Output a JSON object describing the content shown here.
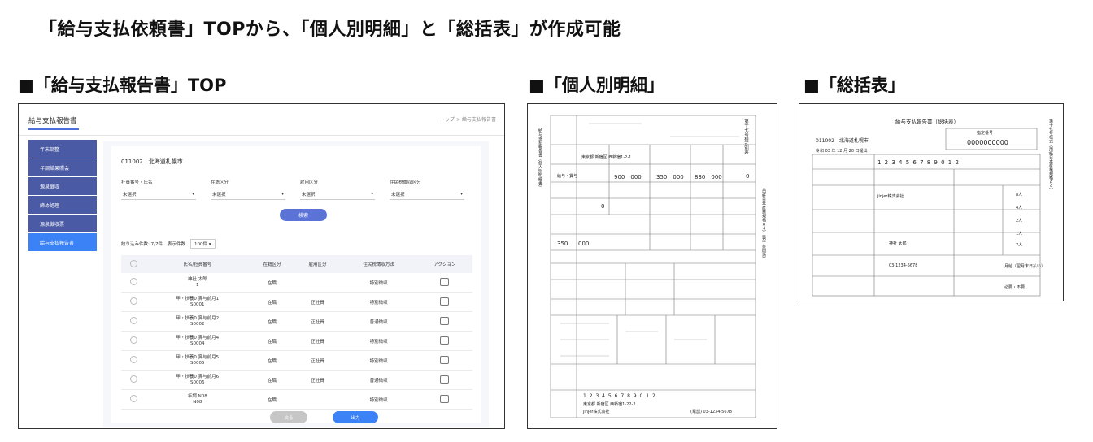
{
  "heading": "「給与支払依頼書」TOPから、「個人別明細」と「総括表」が作成可能",
  "sections": {
    "top": "■「給与支払報告書」TOP",
    "detail": "■「個人別明細」",
    "summary": "■「総括表」"
  },
  "app": {
    "title": "給与支払報告書",
    "breadcrumb": "トップ > 給与支払報告書",
    "sidebar": [
      "年末調整",
      "年調結果照会",
      "源泉徴収",
      "締め処理",
      "源泉徴収票",
      "給与支払報告書"
    ],
    "company": "011002　北海道札幌市",
    "filters": [
      {
        "label": "社員番号・氏名",
        "value": "未選択"
      },
      {
        "label": "在籍区分",
        "value": "未選択"
      },
      {
        "label": "雇用区分",
        "value": "未選択"
      },
      {
        "label": "住民税徴収区分",
        "value": "未選択"
      }
    ],
    "search": "検索",
    "result_count": "絞り込み件数: 7/7件",
    "per_page_label": "表示件数",
    "per_page_value": "100件",
    "columns": [
      "氏名/社員番号",
      "在籍区分",
      "雇用区分",
      "住民税徴収方法",
      "アクション"
    ],
    "rows": [
      {
        "name": "神社 太郎",
        "id": "1",
        "status": "在職",
        "type": "",
        "method": "特別徴収"
      },
      {
        "name": "甲・扶養0 賞与前月1",
        "id": "S0001",
        "status": "在職",
        "type": "正社員",
        "method": "特別徴収"
      },
      {
        "name": "甲・扶養0 賞与前月2",
        "id": "S0002",
        "status": "在職",
        "type": "正社員",
        "method": "普通徴収"
      },
      {
        "name": "甲・扶養0 賞与前月4",
        "id": "S0004",
        "status": "在職",
        "type": "正社員",
        "method": "特別徴収"
      },
      {
        "name": "甲・扶養0 賞与前月5",
        "id": "S0005",
        "status": "在職",
        "type": "正社員",
        "method": "特別徴収"
      },
      {
        "name": "甲・扶養0 賞与前月6",
        "id": "S0006",
        "status": "在職",
        "type": "正社員",
        "method": "普通徴収"
      },
      {
        "name": "年調 N08",
        "id": "N08",
        "status": "在職",
        "type": "",
        "method": "特別徴収"
      }
    ],
    "back": "戻る",
    "output": "出力"
  },
  "detail_form": {
    "address": "東京都 新宿区 西新宿1-2-1",
    "payment_type": "給与・賞与",
    "amount1": "900　000",
    "amount2": "350　000",
    "amount3": "830　000",
    "zero": "0",
    "amount4": "350",
    "amount5": "000",
    "number_boxes": "1 2 3 4 5 6 7 8 9 0 1 2",
    "payer_address": "東京都 新宿区 西新宿1-22-2",
    "payer_name": "jinjer株式会社",
    "tel": "(電話) 03-1234-5678",
    "side_title": "第十七号様式別表",
    "left_vertical": "給与支払報告書（個人別明細書）",
    "right_vertical": "（用紙日本産業規格Ａ４）（第十条関係）"
  },
  "summary_form": {
    "title": "給与支払報告書（総括表）",
    "city": "011002　北海道札幌市",
    "number_label": "指定番号",
    "number": "0000000000",
    "date": "令和 03 年 12 月 20 日提出",
    "corp_number": "1 2 3 4 5 6 7 8 9 0 1 2",
    "company": "jinjer株式会社",
    "rep": "神社 太郎",
    "phone": "03-1234-5678",
    "counts": [
      "8人",
      "4人",
      "2人",
      "1人",
      "7人"
    ],
    "method": "月給（翌月末日払い）",
    "need": "必要・不要",
    "side_title": "第十七号様式（用紙日本産業規格Ａ４）"
  }
}
